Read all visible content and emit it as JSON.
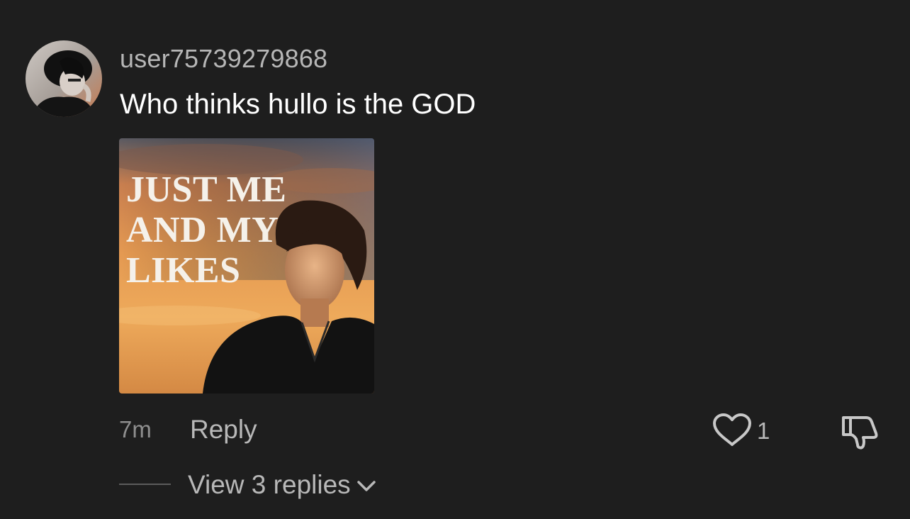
{
  "comment": {
    "username": "user75739279868",
    "text": "Who thinks hullo is the GOD",
    "attached_image": {
      "caption_lines": [
        "JUST ME",
        "AND MY",
        "LIKES"
      ]
    },
    "timestamp": "7m",
    "reply_label": "Reply",
    "like_count": "1",
    "view_replies_label": "View 3 replies"
  },
  "icons": {
    "avatar": "avatar-photo",
    "like": "heart-outline-icon",
    "dislike": "thumbs-down-outline-icon",
    "expand": "chevron-down-icon"
  },
  "colors": {
    "background": "#1e1e1e",
    "username": "#b6b6b6",
    "text": "#ffffff",
    "muted": "#8e8e8e",
    "secondary": "#b8b8b8"
  }
}
